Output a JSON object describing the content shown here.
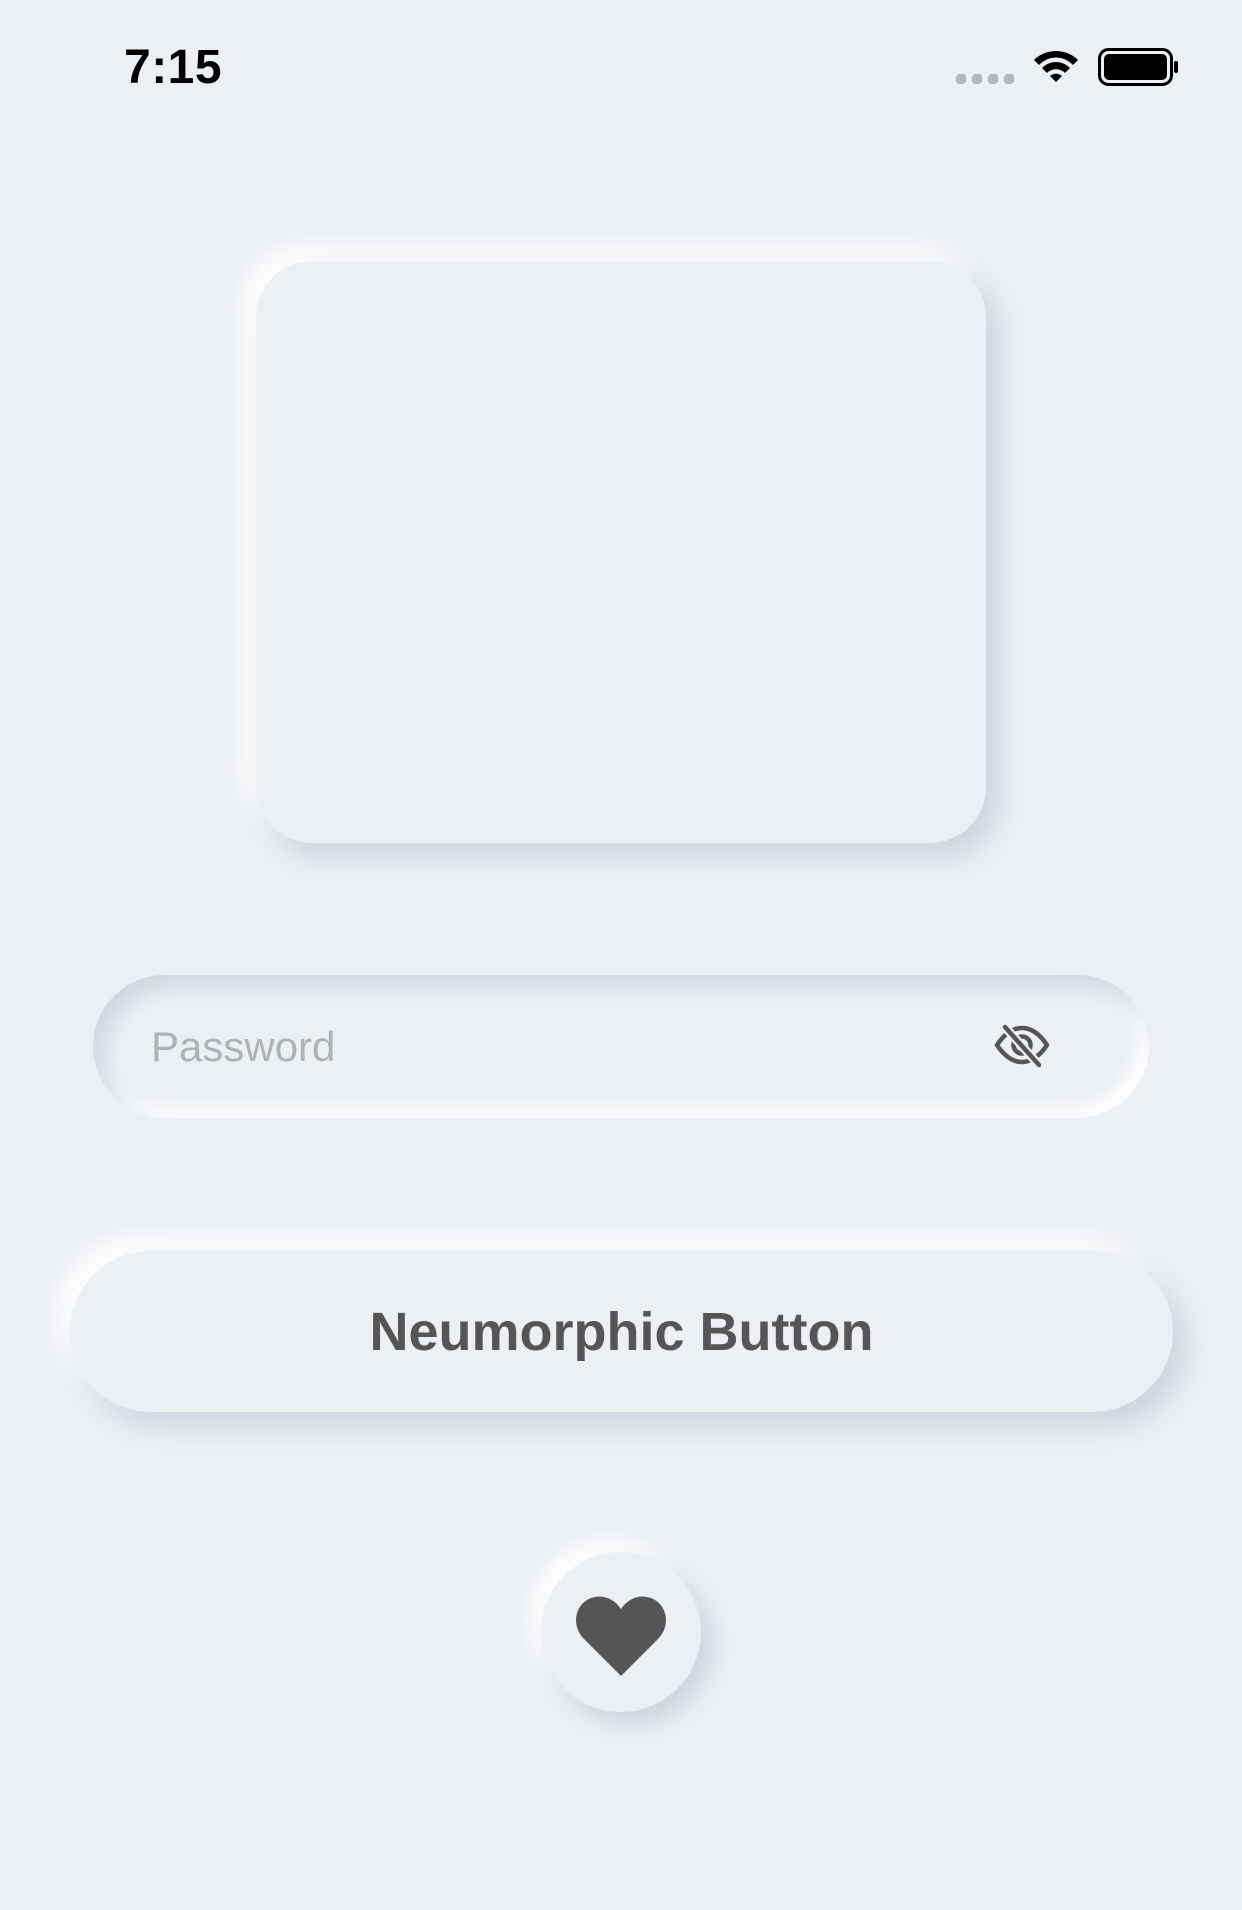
{
  "status_bar": {
    "time": "7:15",
    "signal_icon": "signal-dots-icon",
    "wifi_icon": "wifi-icon",
    "battery_icon": "battery-full-icon"
  },
  "card": {
    "icon": "none"
  },
  "password_field": {
    "value": "",
    "placeholder": "Password",
    "toggle_icon": "eye-slash-icon"
  },
  "button": {
    "label": "Neumorphic Button"
  },
  "heart_button": {
    "icon": "heart-icon"
  },
  "colors": {
    "background": "#ECEFF3",
    "icon": "#555555",
    "placeholder": "#AEB2B8",
    "time": "#000000"
  }
}
